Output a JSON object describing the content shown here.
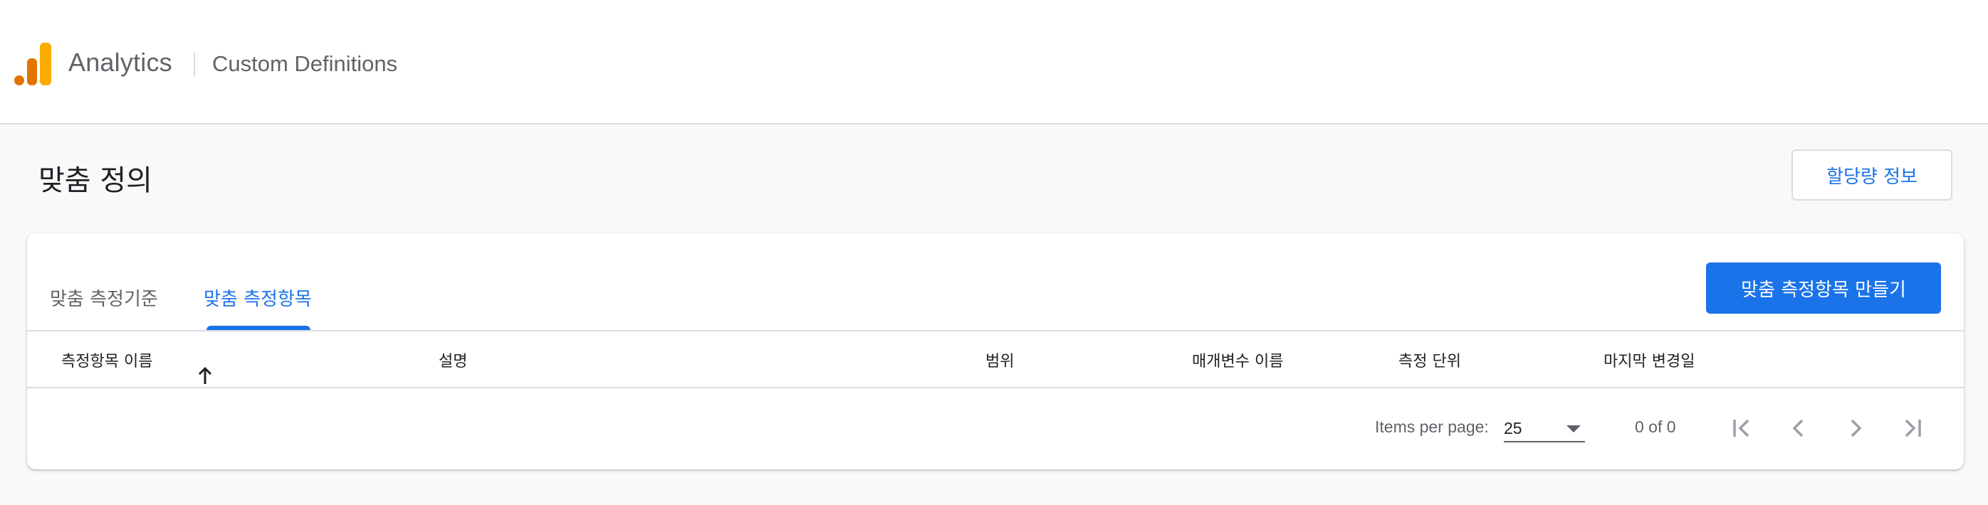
{
  "app": {
    "brand": "Analytics",
    "product": "Custom Definitions",
    "logo_colors": [
      "#e37400",
      "#f9ab00"
    ]
  },
  "page": {
    "title": "맞춤 정의",
    "quota_button": "할당량 정보"
  },
  "tabs": [
    {
      "label": "맞춤 측정기준",
      "active": false
    },
    {
      "label": "맞춤 측정항목",
      "active": true
    }
  ],
  "create_button": "맞춤 측정항목 만들기",
  "table": {
    "columns": [
      "측정항목 이름",
      "설명",
      "범위",
      "매개변수 이름",
      "측정 단위",
      "마지막 변경일"
    ],
    "sorted_column": "측정항목 이름",
    "sort_direction": "ascending",
    "rows": []
  },
  "paginator": {
    "items_per_page_label": "Items per page:",
    "items_per_page": "25",
    "range_label": "0 of 0"
  },
  "colors": {
    "accent": "#1a73e8",
    "background": "#f8f9fa",
    "disabled_icon": "#9aa0a6"
  }
}
